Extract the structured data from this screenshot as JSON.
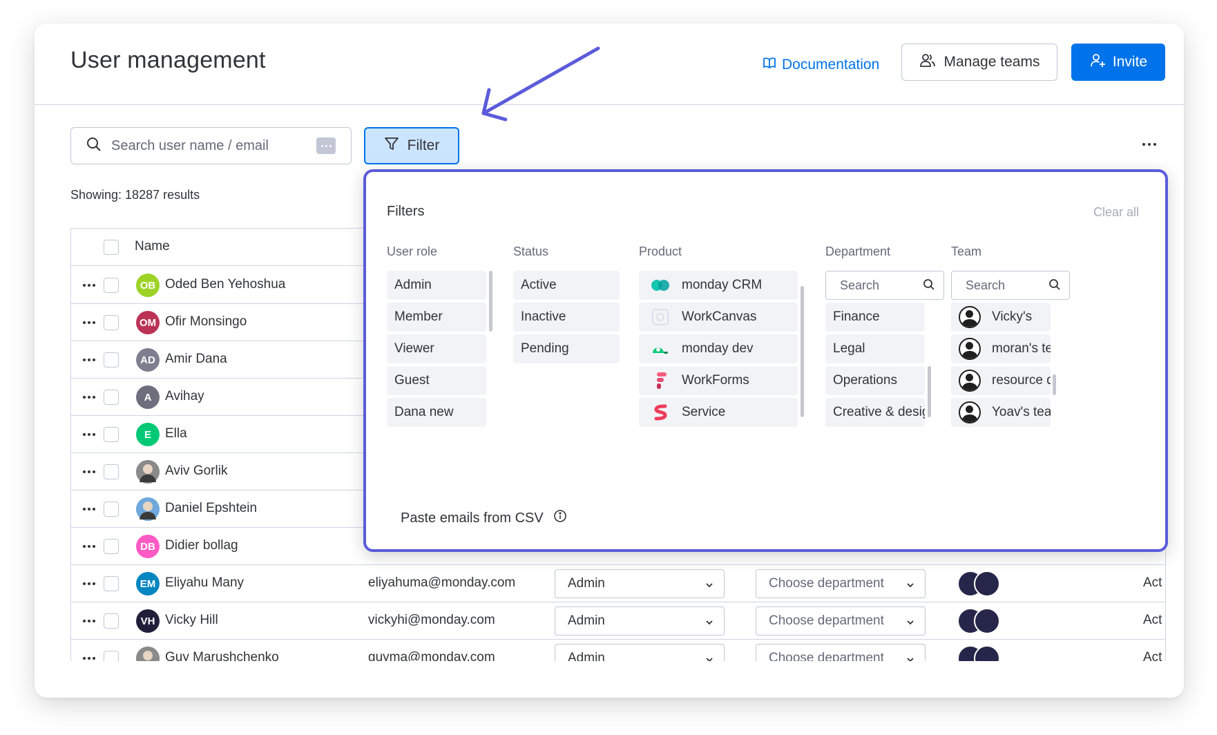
{
  "header": {
    "title": "User management",
    "documentation_label": "Documentation",
    "manage_teams_label": "Manage teams",
    "invite_label": "Invite"
  },
  "toolbar": {
    "search_placeholder": "Search user name / email",
    "filter_label": "Filter",
    "results_text": "Showing: 18287 results"
  },
  "table": {
    "name_header": "Name",
    "rows": [
      {
        "initials": "OB",
        "name": "Oded Ben Yehoshua",
        "avatar_color": "#9cd326",
        "avatar_type": "initials"
      },
      {
        "initials": "OM",
        "name": "Ofir Monsingo",
        "avatar_color": "#bb3354",
        "avatar_type": "initials"
      },
      {
        "initials": "AD",
        "name": "Amir Dana",
        "avatar_color": "#7e7e8f",
        "avatar_type": "initials"
      },
      {
        "initials": "A",
        "name": "Avihay",
        "avatar_color": "#6e6f7d",
        "avatar_type": "initials"
      },
      {
        "initials": "E",
        "name": "Ella",
        "avatar_color": "#00c875",
        "avatar_type": "initials"
      },
      {
        "initials": "",
        "name": "Aviv Gorlik",
        "avatar_color": "#8a8a8a",
        "avatar_type": "photo"
      },
      {
        "initials": "",
        "name": "Daniel Epshtein",
        "avatar_color": "#6fa8dc",
        "avatar_type": "photo"
      },
      {
        "initials": "DB",
        "name": "Didier bollag",
        "avatar_color": "#ff5ac4",
        "avatar_type": "initials"
      },
      {
        "initials": "EM",
        "name": "Eliyahu Many",
        "avatar_color": "#0086c0",
        "avatar_type": "initials",
        "email": "eliyahuma@monday.com",
        "role": "Admin",
        "department": "Choose department",
        "status": "Act"
      },
      {
        "initials": "VH",
        "name": "Vicky Hill",
        "avatar_color": "#1f1f3a",
        "avatar_type": "initials",
        "email": "vickyhi@monday.com",
        "role": "Admin",
        "department": "Choose department",
        "status": "Act"
      },
      {
        "initials": "",
        "name": "Guy Marushchenko",
        "avatar_color": "#8a8a8a",
        "avatar_type": "photo",
        "email": "guyma@monday.com",
        "role": "Admin",
        "department": "Choose department",
        "status": "Act"
      }
    ]
  },
  "filters": {
    "title": "Filters",
    "clear_all": "Clear all",
    "columns": {
      "user_role": {
        "label": "User role",
        "options": [
          "Admin",
          "Member",
          "Viewer",
          "Guest",
          "Dana new"
        ]
      },
      "status": {
        "label": "Status",
        "options": [
          "Active",
          "Inactive",
          "Pending"
        ]
      },
      "product": {
        "label": "Product",
        "options": [
          "monday CRM",
          "WorkCanvas",
          "monday dev",
          "WorkForms",
          "Service"
        ]
      },
      "department": {
        "label": "Department",
        "search_placeholder": "Search",
        "options": [
          "Finance",
          "Legal",
          "Operations",
          "Creative & desigi"
        ]
      },
      "team": {
        "label": "Team",
        "search_placeholder": "Search",
        "options": [
          "Vicky's",
          "moran's tea",
          "resource di",
          "Yoav's tear"
        ]
      }
    },
    "csv_label": "Paste emails from CSV"
  },
  "colors": {
    "primary": "#0073ea",
    "filter_active_bg": "#cce5ff",
    "panel_highlight": "#5b5bdb"
  }
}
